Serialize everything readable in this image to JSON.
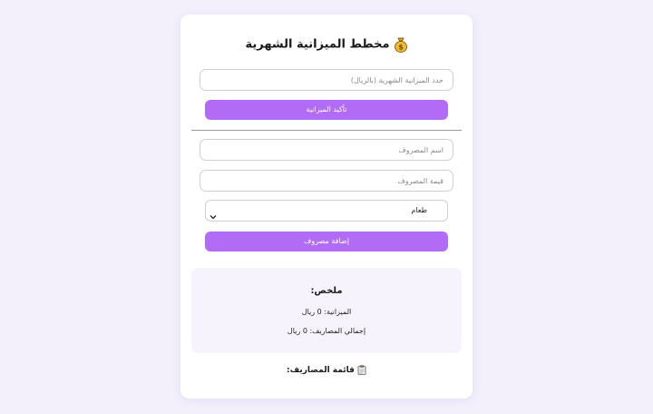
{
  "app": {
    "title": "مخطط الميزانية الشهرية",
    "title_icon": "money-bag-icon"
  },
  "budget": {
    "placeholder": "حدد الميزانية الشهرية (بالريال)",
    "value": "",
    "button_label": "تأكيد الميزانية"
  },
  "expense": {
    "name_placeholder": "اسم المصروف",
    "amount_placeholder": "قيمة المصروف",
    "category_selected": "طعام",
    "button_label": "إضافة مصروف"
  },
  "summary": {
    "title": "ملخص:",
    "budget_line": "الميزانية: 0 ريال",
    "total_line": "إجمالي المصاريف: 0 ريال"
  },
  "expenses_list": {
    "title": "قائمة المصاريف:",
    "icon": "clipboard-icon",
    "items": []
  },
  "colors": {
    "accent": "#b26bf5",
    "background": "#f3f0fc",
    "summary_bg": "#f6f3fd"
  }
}
